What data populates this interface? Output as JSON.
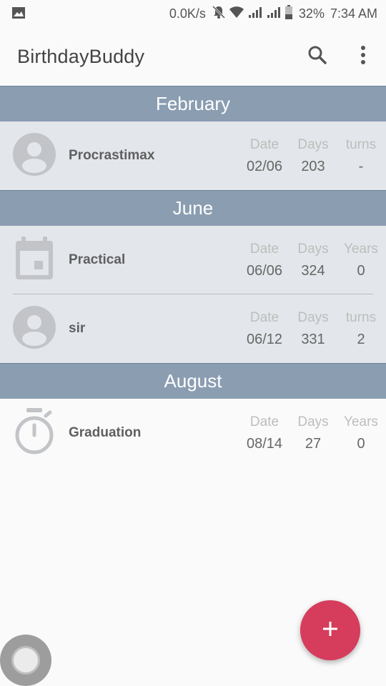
{
  "status_bar": {
    "speed": "0.0K/s",
    "battery": "32%",
    "time": "7:34 AM"
  },
  "app_bar": {
    "title": "BirthdayBuddy",
    "search_icon": "search-icon",
    "overflow_icon": "more-vert-icon"
  },
  "sections": [
    {
      "month": "February",
      "events": [
        {
          "name": "Procrastimax",
          "icon": "person-icon",
          "date_label": "Date",
          "days_label": "Days",
          "third_label": "turns",
          "date": "02/06",
          "days": "203",
          "third": "-"
        }
      ]
    },
    {
      "month": "June",
      "events": [
        {
          "name": "Practical",
          "icon": "calendar-icon",
          "date_label": "Date",
          "days_label": "Days",
          "third_label": "Years",
          "date": "06/06",
          "days": "324",
          "third": "0"
        },
        {
          "name": "sir",
          "icon": "person-icon",
          "date_label": "Date",
          "days_label": "Days",
          "third_label": "turns",
          "date": "06/12",
          "days": "331",
          "third": "2"
        }
      ]
    },
    {
      "month": "August",
      "events": [
        {
          "name": "Graduation",
          "icon": "stopwatch-icon",
          "date_label": "Date",
          "days_label": "Days",
          "third_label": "Years",
          "date": "08/14",
          "days": "27",
          "third": "0"
        }
      ]
    }
  ],
  "fab": {
    "icon": "add-icon",
    "label": "+"
  },
  "colors": {
    "section_header": "#8a9db1",
    "row_bg": "#e3e6ea",
    "fab": "#d63c5c"
  }
}
